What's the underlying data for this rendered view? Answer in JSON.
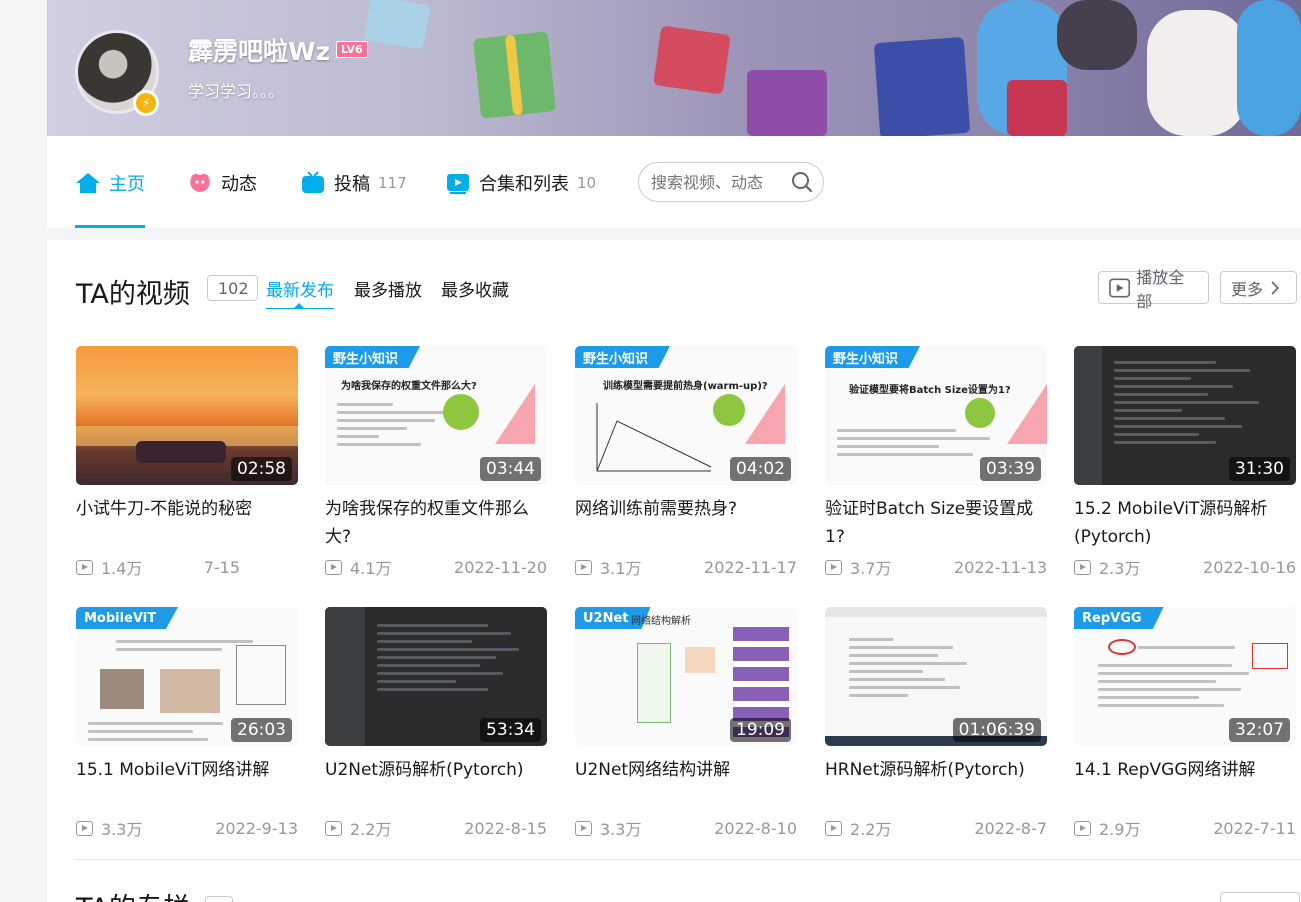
{
  "profile": {
    "username": "霹雳吧啦Wz",
    "level": "LV6",
    "sign": "学习学习。。。"
  },
  "nav": {
    "tabs": [
      {
        "label": "主页",
        "count": ""
      },
      {
        "label": "动态",
        "count": ""
      },
      {
        "label": "投稿",
        "count": "117"
      },
      {
        "label": "合集和列表",
        "count": "10"
      }
    ],
    "search_placeholder": "搜索视频、动态"
  },
  "videos_section": {
    "title": "TA的视频",
    "count": "102",
    "sort_options": [
      "最新发布",
      "最多播放",
      "最多收藏"
    ],
    "play_all_label": "播放全部",
    "more_label": "更多"
  },
  "videos": [
    {
      "title": "小试牛刀-不能说的秘密",
      "duration": "02:58",
      "plays": "1.4万",
      "date": "7-15",
      "tag": ""
    },
    {
      "title": "为啥我保存的权重文件那么大?",
      "duration": "03:44",
      "plays": "4.1万",
      "date": "2022-11-20",
      "tag": "野生小知识"
    },
    {
      "title": "网络训练前需要热身?",
      "duration": "04:02",
      "plays": "3.1万",
      "date": "2022-11-17",
      "tag": "野生小知识"
    },
    {
      "title": "验证时Batch Size要设置成1?",
      "duration": "03:39",
      "plays": "3.7万",
      "date": "2022-11-13",
      "tag": "野生小知识"
    },
    {
      "title": "15.2 MobileViT源码解析(Pytorch)",
      "duration": "31:30",
      "plays": "2.3万",
      "date": "2022-10-16",
      "tag": ""
    },
    {
      "title": "15.1 MobileViT网络讲解",
      "duration": "26:03",
      "plays": "3.3万",
      "date": "2022-9-13",
      "tag": "MobileViT"
    },
    {
      "title": "U2Net源码解析(Pytorch)",
      "duration": "53:34",
      "plays": "2.2万",
      "date": "2022-8-15",
      "tag": ""
    },
    {
      "title": "U2Net网络结构讲解",
      "duration": "19:09",
      "plays": "3.3万",
      "date": "2022-8-10",
      "tag": "U2Net"
    },
    {
      "title": "HRNet源码解析(Pytorch)",
      "duration": "01:06:39",
      "plays": "2.2万",
      "date": "2022-8-7",
      "tag": ""
    },
    {
      "title": "14.1 RepVGG网络讲解",
      "duration": "32:07",
      "plays": "2.9万",
      "date": "2022-7-11",
      "tag": "RepVGG"
    }
  ],
  "thumb_texts": {
    "v1": "为啥我保存的权重文件那么大?",
    "v2": "训练模型需要提前热身(warm-up)?",
    "v3": "验证模型要将Batch Size设置为1?",
    "v7": "网络结构解析"
  },
  "next_section": {
    "title": "TA的专栏"
  },
  "colors": {
    "accent": "#00aeec",
    "level": "#fb7299",
    "tag": "#1e9be8"
  }
}
